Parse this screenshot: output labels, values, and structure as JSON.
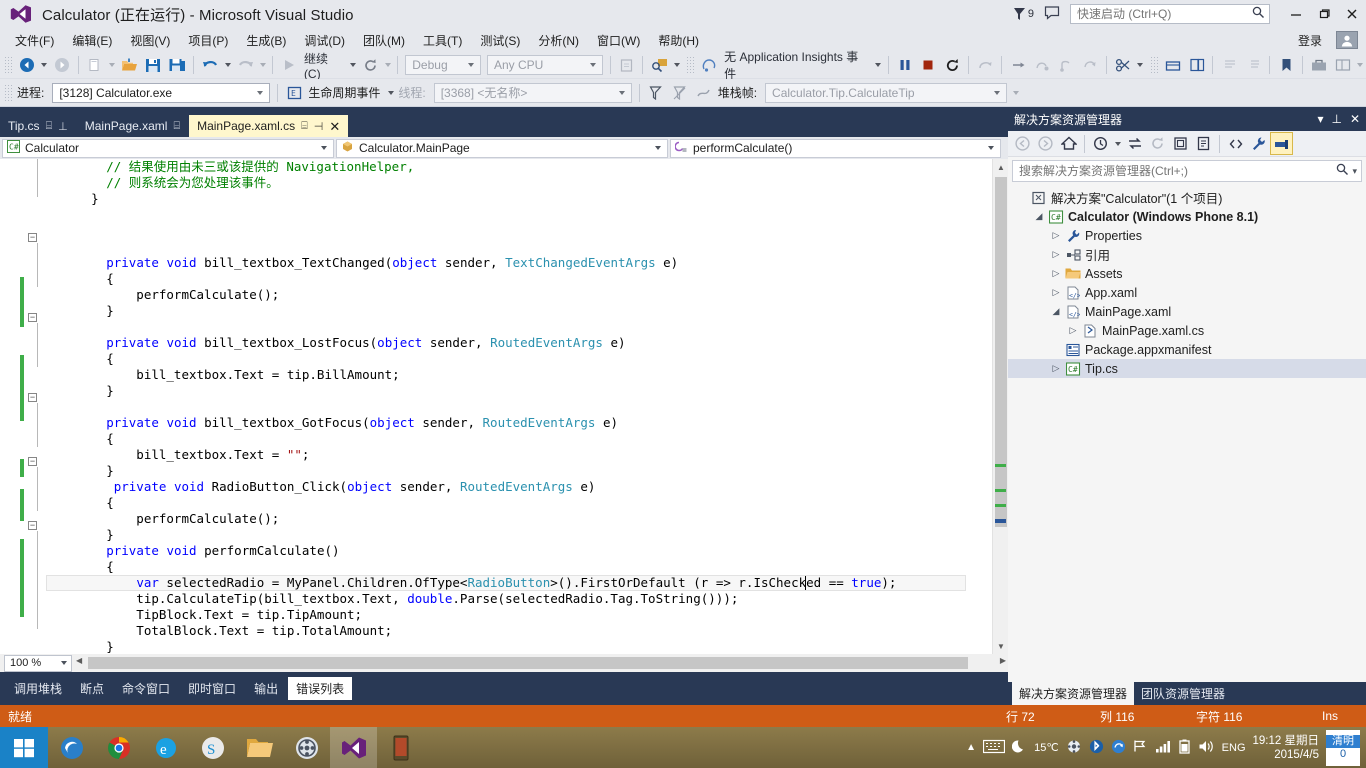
{
  "window": {
    "title": "Calculator (正在运行) - Microsoft Visual Studio",
    "logo_icon": "visual-studio-logo",
    "notification_count": "9",
    "minimize_label": "─",
    "maximize_label": "❐",
    "close_label": "✕"
  },
  "quick_launch": {
    "placeholder": "快速启动 (Ctrl+Q)",
    "value": "",
    "icon": "search-icon"
  },
  "menu": {
    "items": [
      {
        "label": "文件(F)"
      },
      {
        "label": "编辑(E)"
      },
      {
        "label": "视图(V)"
      },
      {
        "label": "项目(P)"
      },
      {
        "label": "生成(B)"
      },
      {
        "label": "调试(D)"
      },
      {
        "label": "团队(M)"
      },
      {
        "label": "工具(T)"
      },
      {
        "label": "测试(S)"
      },
      {
        "label": "分析(N)"
      },
      {
        "label": "窗口(W)"
      },
      {
        "label": "帮助(H)"
      }
    ],
    "signin_label": "登录"
  },
  "toolbar": {
    "continue_label": "继续(C)",
    "configuration": "Debug",
    "platform": "Any CPU",
    "app_insights_label": "无 Application Insights 事件"
  },
  "debug_bar": {
    "process_label": "进程:",
    "process_value": "[3128] Calculator.exe",
    "lifecycle_label": "生命周期事件",
    "thread_label": "线程:",
    "thread_value": "[3368] <无名称>",
    "stackframe_label": "堆栈帧:",
    "stackframe_value": "Calculator.Tip.CalculateTip"
  },
  "tabs": [
    {
      "label": "Tip.cs",
      "active": false,
      "pinned": true
    },
    {
      "label": "MainPage.xaml",
      "active": false,
      "pinned": false
    },
    {
      "label": "MainPage.xaml.cs",
      "active": true,
      "pinned": true
    }
  ],
  "navbar": {
    "project": "Calculator",
    "type": "Calculator.MainPage",
    "member": "performCalculate()",
    "project_icon": "csharp-icon",
    "type_icon": "class-icon",
    "member_icon": "method-icon"
  },
  "editor": {
    "zoom": "100 %",
    "code_lines": [
      {
        "indent": 8,
        "segments": [
          {
            "t": "// 结果使用由未三或该提供的 NavigationHelper,",
            "c": "c"
          }
        ]
      },
      {
        "indent": 8,
        "segments": [
          {
            "t": "// 则系统会为您处理该事件。",
            "c": "c"
          }
        ]
      },
      {
        "indent": 6,
        "segments": [
          {
            "t": "}",
            "c": ""
          }
        ]
      },
      {
        "indent": 0,
        "segments": []
      },
      {
        "indent": 0,
        "segments": []
      },
      {
        "indent": 0,
        "segments": []
      },
      {
        "indent": 8,
        "segments": [
          {
            "t": "private",
            "c": "k"
          },
          {
            "t": " ",
            "c": ""
          },
          {
            "t": "void",
            "c": "k"
          },
          {
            "t": " bill_textbox_TextChanged(",
            "c": ""
          },
          {
            "t": "object",
            "c": "k"
          },
          {
            "t": " sender, ",
            "c": ""
          },
          {
            "t": "TextChangedEventArgs",
            "c": "t"
          },
          {
            "t": " e)",
            "c": ""
          }
        ]
      },
      {
        "indent": 8,
        "segments": [
          {
            "t": "{",
            "c": ""
          }
        ]
      },
      {
        "indent": 12,
        "segments": [
          {
            "t": "performCalculate();",
            "c": ""
          }
        ]
      },
      {
        "indent": 8,
        "segments": [
          {
            "t": "}",
            "c": ""
          }
        ]
      },
      {
        "indent": 0,
        "segments": []
      },
      {
        "indent": 8,
        "segments": [
          {
            "t": "private",
            "c": "k"
          },
          {
            "t": " ",
            "c": ""
          },
          {
            "t": "void",
            "c": "k"
          },
          {
            "t": " bill_textbox_LostFocus(",
            "c": ""
          },
          {
            "t": "object",
            "c": "k"
          },
          {
            "t": " sender, ",
            "c": ""
          },
          {
            "t": "RoutedEventArgs",
            "c": "t"
          },
          {
            "t": " e)",
            "c": ""
          }
        ]
      },
      {
        "indent": 8,
        "segments": [
          {
            "t": "{",
            "c": ""
          }
        ]
      },
      {
        "indent": 12,
        "segments": [
          {
            "t": "bill_textbox.Text = tip.BillAmount;",
            "c": ""
          }
        ]
      },
      {
        "indent": 8,
        "segments": [
          {
            "t": "}",
            "c": ""
          }
        ]
      },
      {
        "indent": 0,
        "segments": []
      },
      {
        "indent": 8,
        "segments": [
          {
            "t": "private",
            "c": "k"
          },
          {
            "t": " ",
            "c": ""
          },
          {
            "t": "void",
            "c": "k"
          },
          {
            "t": " bill_textbox_GotFocus(",
            "c": ""
          },
          {
            "t": "object",
            "c": "k"
          },
          {
            "t": " sender, ",
            "c": ""
          },
          {
            "t": "RoutedEventArgs",
            "c": "t"
          },
          {
            "t": " e)",
            "c": ""
          }
        ]
      },
      {
        "indent": 8,
        "segments": [
          {
            "t": "{",
            "c": ""
          }
        ]
      },
      {
        "indent": 12,
        "segments": [
          {
            "t": "bill_textbox.Text = ",
            "c": ""
          },
          {
            "t": "\"\"",
            "c": "s"
          },
          {
            "t": ";",
            "c": ""
          }
        ]
      },
      {
        "indent": 8,
        "segments": [
          {
            "t": "}",
            "c": ""
          }
        ]
      },
      {
        "indent": 9,
        "segments": [
          {
            "t": "private",
            "c": "k"
          },
          {
            "t": " ",
            "c": ""
          },
          {
            "t": "void",
            "c": "k"
          },
          {
            "t": " RadioButton_Click(",
            "c": ""
          },
          {
            "t": "object",
            "c": "k"
          },
          {
            "t": " sender, ",
            "c": ""
          },
          {
            "t": "RoutedEventArgs",
            "c": "t"
          },
          {
            "t": " e)",
            "c": ""
          }
        ]
      },
      {
        "indent": 8,
        "segments": [
          {
            "t": "{",
            "c": ""
          }
        ]
      },
      {
        "indent": 12,
        "segments": [
          {
            "t": "performCalculate();",
            "c": ""
          }
        ]
      },
      {
        "indent": 8,
        "segments": [
          {
            "t": "}",
            "c": ""
          }
        ]
      },
      {
        "indent": 8,
        "segments": [
          {
            "t": "private",
            "c": "k"
          },
          {
            "t": " ",
            "c": ""
          },
          {
            "t": "void",
            "c": "k"
          },
          {
            "t": " performCalculate()",
            "c": ""
          }
        ]
      },
      {
        "indent": 8,
        "segments": [
          {
            "t": "{",
            "c": ""
          }
        ]
      },
      {
        "indent": 12,
        "segments": [
          {
            "t": "var",
            "c": "k"
          },
          {
            "t": " selectedRadio = MyPanel.Children.OfType<",
            "c": ""
          },
          {
            "t": "RadioButton",
            "c": "t"
          },
          {
            "t": ">().FirstOrDefault (r => r.IsChecked == ",
            "c": ""
          },
          {
            "t": "true",
            "c": "k"
          },
          {
            "t": ");",
            "c": ""
          }
        ]
      },
      {
        "indent": 12,
        "segments": [
          {
            "t": "tip.CalculateTip(bill_textbox.Text, ",
            "c": ""
          },
          {
            "t": "double",
            "c": "k"
          },
          {
            "t": ".Parse(selectedRadio.Tag.ToString()));",
            "c": ""
          }
        ]
      },
      {
        "indent": 12,
        "segments": [
          {
            "t": "TipBlock.Text = tip.TipAmount;",
            "c": ""
          }
        ]
      },
      {
        "indent": 12,
        "segments": [
          {
            "t": "TotalBlock.Text = tip.TotalAmount;",
            "c": ""
          }
        ]
      },
      {
        "indent": 8,
        "segments": [
          {
            "t": "}",
            "c": ""
          }
        ]
      }
    ],
    "current_line_index": 26
  },
  "bottom_panel": {
    "tabs": [
      {
        "label": "调用堆栈",
        "active": false
      },
      {
        "label": "断点",
        "active": false
      },
      {
        "label": "命令窗口",
        "active": false
      },
      {
        "label": "即时窗口",
        "active": false
      },
      {
        "label": "输出",
        "active": false
      },
      {
        "label": "错误列表",
        "active": true
      }
    ]
  },
  "solution_explorer": {
    "title": "解决方案资源管理器",
    "search_placeholder": "搜索解决方案资源管理器(Ctrl+;)",
    "search_value": "",
    "toolbar_icons": [
      "back-icon",
      "forward-icon",
      "home-icon",
      "pending-changes-icon",
      "sync-icon",
      "refresh-icon",
      "collapse-all-icon",
      "properties-icon",
      "show-all-files-icon",
      "wrench-icon",
      "preview-selected-items-icon"
    ],
    "tree": [
      {
        "depth": 0,
        "twisty": "none",
        "icon": "solution-icon",
        "label": "解决方案\"Calculator\"(1 个项目)",
        "bold": false,
        "selected": false
      },
      {
        "depth": 1,
        "twisty": "open",
        "icon": "csharp-project-icon",
        "label": "Calculator (Windows Phone 8.1)",
        "bold": true,
        "selected": false
      },
      {
        "depth": 2,
        "twisty": "closed",
        "icon": "properties-icon",
        "label": "Properties",
        "bold": false,
        "selected": false
      },
      {
        "depth": 2,
        "twisty": "closed",
        "icon": "references-icon",
        "label": "引用",
        "bold": false,
        "selected": false
      },
      {
        "depth": 2,
        "twisty": "closed",
        "icon": "folder-icon",
        "label": "Assets",
        "bold": false,
        "selected": false
      },
      {
        "depth": 2,
        "twisty": "closed",
        "icon": "xaml-file-icon",
        "label": "App.xaml",
        "bold": false,
        "selected": false
      },
      {
        "depth": 2,
        "twisty": "open",
        "icon": "xaml-file-icon",
        "label": "MainPage.xaml",
        "bold": false,
        "selected": false
      },
      {
        "depth": 3,
        "twisty": "closed",
        "icon": "code-file-icon",
        "label": "MainPage.xaml.cs",
        "bold": false,
        "selected": false
      },
      {
        "depth": 2,
        "twisty": "none",
        "icon": "manifest-icon",
        "label": "Package.appxmanifest",
        "bold": false,
        "selected": false
      },
      {
        "depth": 2,
        "twisty": "closed",
        "icon": "csharp-icon",
        "label": "Tip.cs",
        "bold": false,
        "selected": true
      }
    ],
    "bottom_tabs": [
      {
        "label": "解决方案资源管理器",
        "active": true
      },
      {
        "label": "团队资源管理器",
        "active": false
      }
    ]
  },
  "statusbar": {
    "status": "就绪",
    "line_label": "行 72",
    "col_label": "列 116",
    "char_label": "字符 116",
    "insert_mode": "Ins",
    "accent": "#cf5c16"
  },
  "taskbar": {
    "start_icon": "windows-start-icon",
    "pinned": [
      {
        "icon": "firefox-dev-icon",
        "name": "taskbar-firefox-dev"
      },
      {
        "icon": "chrome-icon",
        "name": "taskbar-chrome"
      },
      {
        "icon": "ie-icon",
        "name": "taskbar-internet-explorer"
      },
      {
        "icon": "skype-icon",
        "name": "taskbar-skype"
      },
      {
        "icon": "explorer-icon",
        "name": "taskbar-file-explorer"
      },
      {
        "icon": "media-icon",
        "name": "taskbar-media-player"
      },
      {
        "icon": "visual-studio-icon",
        "name": "taskbar-visual-studio"
      },
      {
        "icon": "phone-emulator-icon",
        "name": "taskbar-phone-emulator"
      }
    ],
    "tray": {
      "keyboard_icon": "keyboard-icon",
      "weather_icon": "moon-icon",
      "temperature": "15℃",
      "network_icon": "signal-icon",
      "bluetooth_icon": "bluetooth-icon",
      "sync_icon": "sync-icon",
      "flag_icon": "flag-icon",
      "battery_icon": "battery-icon",
      "volume_icon": "volume-icon",
      "language": "ENG",
      "time": "19:12 星期日",
      "date": "2015/4/5",
      "ime_label": "清明",
      "ime_sub": "0"
    }
  }
}
